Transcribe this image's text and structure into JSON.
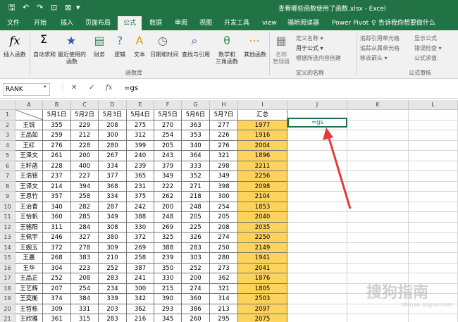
{
  "window": {
    "title": "查看哪些函数使用了函数.xlsx - Excel"
  },
  "quick_access": {
    "save_icon": "save-icon",
    "undo_icon": "undo-icon",
    "redo_icon": "redo-icon",
    "more": "▾"
  },
  "menu": {
    "tabs": [
      "文件",
      "开始",
      "插入",
      "页面布局",
      "公式",
      "数据",
      "审阅",
      "视图",
      "开发工具",
      "view",
      "福昕阅读器",
      "Power Pivot",
      "告诉我你想要做什么"
    ],
    "active": "公式"
  },
  "ribbon": {
    "insert_function": "插入函数",
    "autosum": "自动求和",
    "recent": "最近使用的\n函数",
    "financial": "财务",
    "logical": "逻辑",
    "text": "文本",
    "datetime": "日期和时间",
    "lookup": "查找与引用",
    "math": "数学和\n三角函数",
    "more": "其他函数",
    "group_library": "函数库",
    "name_manager": "名称\n管理器",
    "define_name": "定义名称 ▾",
    "use_in_formula": "用于公式 ▾",
    "create_from_selection": "根据所选内容创建",
    "group_names": "定义的名称",
    "trace_precedents": "追踪引用单元格",
    "trace_dependents": "追踪从属单元格",
    "remove_arrows": "移去箭头 ▾",
    "show_formulas": "显示公式",
    "error_checking": "错误检查 ▾",
    "evaluate_formula": "公式求值",
    "group_audit": "公式审核"
  },
  "formula_bar": {
    "name_box": "RANK",
    "cancel": "✕",
    "enter": "✓",
    "fx": "fx",
    "value": "=gs"
  },
  "sheet": {
    "columns": [
      "A",
      "B",
      "C",
      "D",
      "E",
      "F",
      "G",
      "H",
      "I",
      "J",
      "K",
      "L",
      "M"
    ],
    "header_row": [
      "",
      "5月1日",
      "5月2日",
      "5月3日",
      "5月4日",
      "5月5日",
      "5月6日",
      "5月7日",
      "汇总"
    ],
    "rows": [
      [
        "王锐",
        "355",
        "229",
        "208",
        "275",
        "270",
        "363",
        "277",
        "1977"
      ],
      [
        "王品如",
        "259",
        "212",
        "300",
        "312",
        "254",
        "353",
        "226",
        "1916"
      ],
      [
        "王红",
        "276",
        "228",
        "280",
        "399",
        "205",
        "340",
        "276",
        "2004"
      ],
      [
        "王泽文",
        "261",
        "200",
        "267",
        "240",
        "243",
        "364",
        "321",
        "1896"
      ],
      [
        "王籽菡",
        "228",
        "400",
        "334",
        "239",
        "379",
        "333",
        "298",
        "2211"
      ],
      [
        "王浩铭",
        "237",
        "227",
        "377",
        "365",
        "349",
        "352",
        "349",
        "2256"
      ],
      [
        "王译文",
        "214",
        "394",
        "368",
        "231",
        "222",
        "271",
        "398",
        "2098"
      ],
      [
        "王恩竹",
        "357",
        "258",
        "334",
        "375",
        "262",
        "218",
        "300",
        "2104"
      ],
      [
        "王治青",
        "340",
        "282",
        "287",
        "242",
        "200",
        "248",
        "254",
        "1853"
      ],
      [
        "王怡帆",
        "360",
        "285",
        "349",
        "388",
        "248",
        "205",
        "205",
        "2040"
      ],
      [
        "王骆阳",
        "311",
        "284",
        "308",
        "330",
        "269",
        "225",
        "208",
        "2035"
      ],
      [
        "王佩宇",
        "246",
        "327",
        "380",
        "372",
        "325",
        "326",
        "274",
        "2250"
      ],
      [
        "王婉玉",
        "372",
        "278",
        "309",
        "269",
        "388",
        "283",
        "250",
        "2149"
      ],
      [
        "王嘉",
        "268",
        "383",
        "210",
        "258",
        "239",
        "303",
        "280",
        "1941"
      ],
      [
        "王华",
        "304",
        "223",
        "252",
        "387",
        "350",
        "252",
        "273",
        "2041"
      ],
      [
        "王品正",
        "252",
        "208",
        "283",
        "241",
        "330",
        "200",
        "362",
        "1876"
      ],
      [
        "王艺辉",
        "207",
        "254",
        "234",
        "300",
        "215",
        "274",
        "321",
        "1805"
      ],
      [
        "王奕衡",
        "374",
        "384",
        "339",
        "342",
        "390",
        "360",
        "314",
        "2503"
      ],
      [
        "王哲栋",
        "309",
        "331",
        "203",
        "362",
        "293",
        "386",
        "213",
        "2097"
      ],
      [
        "王欣雅",
        "361",
        "315",
        "283",
        "216",
        "345",
        "260",
        "295",
        "2075"
      ]
    ],
    "active_cell_value": "=gs",
    "summary_color": "#fdd35c"
  },
  "watermark": {
    "text": "搜狗指南",
    "sub": "zhinan.sogou.com"
  },
  "colors": {
    "excel_green": "#217346",
    "arrow": "#e33b3b"
  }
}
